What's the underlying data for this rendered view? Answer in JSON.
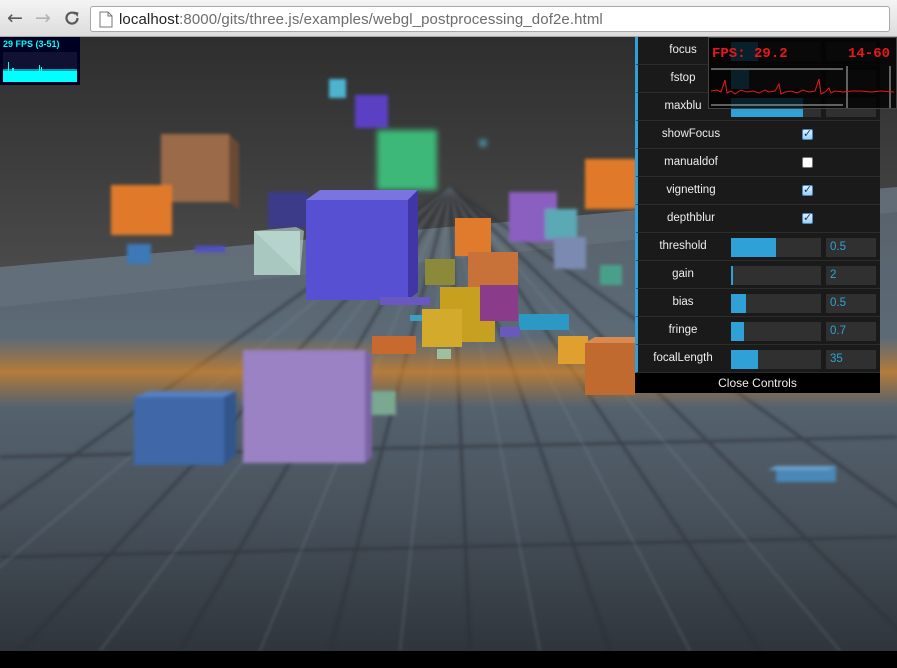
{
  "browser": {
    "url_host": "localhost",
    "url_path": ":8000/gits/three.js/examples/webgl_postprocessing_dof2e.html"
  },
  "stats": {
    "text": "29 FPS (3-51)",
    "color": "#00ffff"
  },
  "fps_overlay": {
    "fps_text": "FPS: 29.2",
    "range_text": "14-60",
    "color": "#e8181b"
  },
  "gui": {
    "accent": "#2fa1d6",
    "sliders_top": [
      {
        "label": "focus"
      },
      {
        "label": "fstop"
      },
      {
        "label": "maxblu"
      }
    ],
    "booleans": [
      {
        "label": "showFocus",
        "checked": true
      },
      {
        "label": "manualdof",
        "checked": false
      },
      {
        "label": "vignetting",
        "checked": true
      },
      {
        "label": "depthblur",
        "checked": true
      }
    ],
    "sliders": [
      {
        "label": "threshold",
        "value": "0.5",
        "fill": 0.5
      },
      {
        "label": "gain",
        "value": "2",
        "fill": 0.02
      },
      {
        "label": "bias",
        "value": "0.5",
        "fill": 0.17
      },
      {
        "label": "fringe",
        "value": "0.7",
        "fill": 0.14
      },
      {
        "label": "focalLength",
        "value": "35",
        "fill": 0.3
      }
    ],
    "close_label": "Close Controls"
  }
}
